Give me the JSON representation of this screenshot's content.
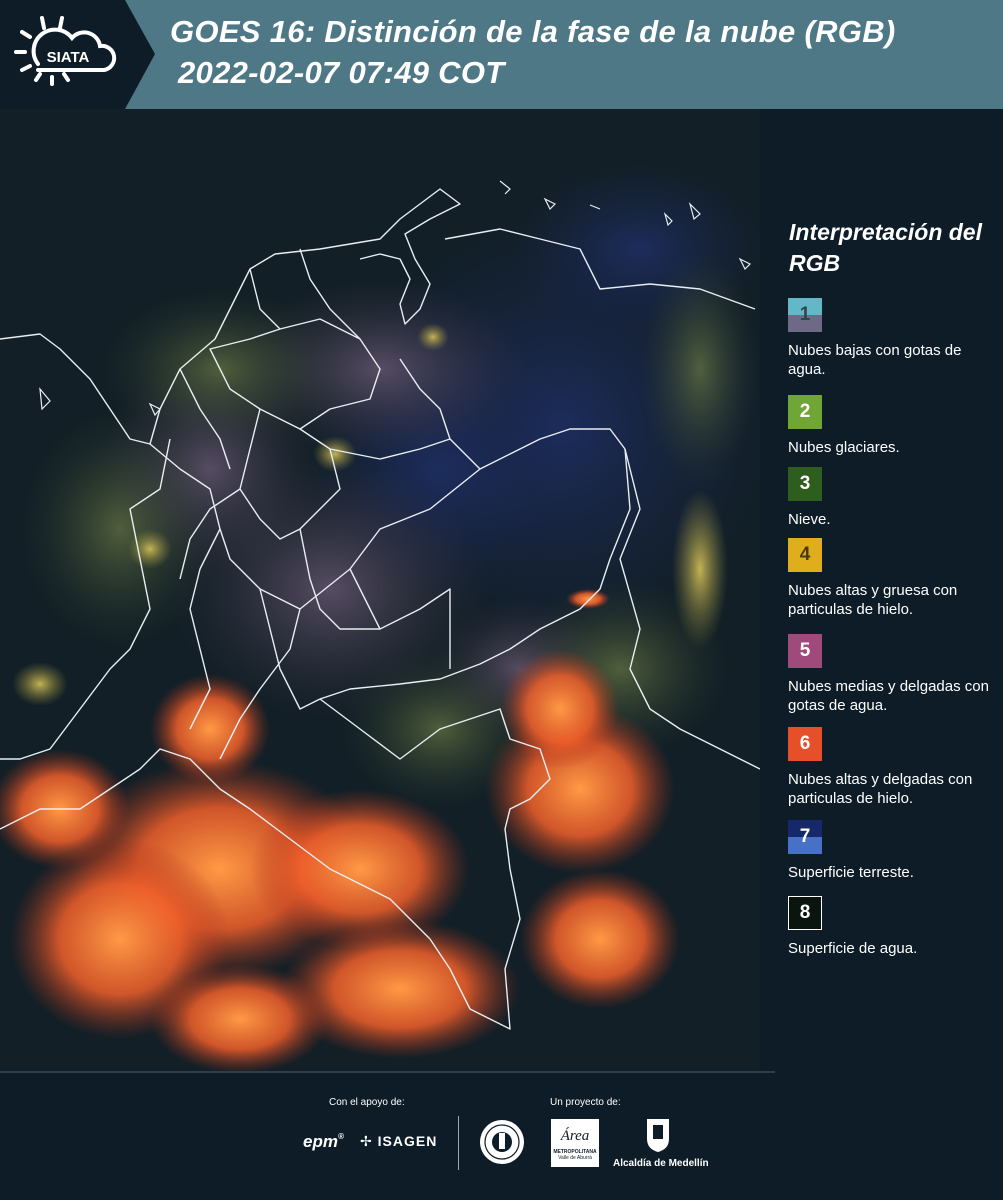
{
  "header": {
    "logo_text": "SIATA",
    "title_line1": "GOES 16: Distinción de la fase de la nube (RGB)",
    "title_line2": "2022-02-07 07:49 COT"
  },
  "legend": {
    "title": "Interpretación del RGB",
    "items": [
      {
        "number": "1",
        "label": "Nubes bajas con gotas de agua.",
        "color_top": "#62b8c6",
        "color_bottom": "#6e6a86",
        "num_color": "#3b3f4c"
      },
      {
        "number": "2",
        "label": "Nubes glaciares.",
        "color_top": "#6fa636",
        "color_bottom": "#6fa636",
        "num_color": "#ffffff"
      },
      {
        "number": "3",
        "label": "Nieve.",
        "color_top": "#2d5e1d",
        "color_bottom": "#2d5e1d",
        "num_color": "#ffffff"
      },
      {
        "number": "4",
        "label": "Nubes altas y gruesa con particulas de hielo.",
        "color_top": "#e0ad1c",
        "color_bottom": "#e0ad1c",
        "num_color": "#4a3a10"
      },
      {
        "number": "5",
        "label": "Nubes medias y delgadas con gotas de agua.",
        "color_top": "#a04a7c",
        "color_bottom": "#a04a7c",
        "num_color": "#ffffff"
      },
      {
        "number": "6",
        "label": "Nubes altas y delgadas con particulas de hielo.",
        "color_top": "#e5502b",
        "color_bottom": "#e5502b",
        "num_color": "#ffffff"
      },
      {
        "number": "7",
        "label": "Superficie terreste.",
        "color_top": "#14286a",
        "color_bottom": "#4671c4",
        "num_color": "#ffffff"
      },
      {
        "number": "8",
        "label": "Superficie de agua.",
        "color_top": "#0b1510",
        "color_bottom": "#0b1510",
        "num_color": "#ffffff"
      }
    ]
  },
  "footer": {
    "support_caption": "Con el apoyo de:",
    "project_caption": "Un proyecto de:",
    "sponsor_epm": "epm",
    "sponsor_isagen": "ISAGEN",
    "area_logo_text": "Área",
    "area_subtitle": "METROPOLITANA",
    "area_subtitle2": "Valle de Aburrá",
    "alcaldia": "Alcaldía de Medellín"
  },
  "colors": {
    "header_bg": "#4f7886",
    "logo_bg": "#0d1c27",
    "page_bg": "#0d1c27",
    "cloud_orange": "#f26a30",
    "water_dark": "#1b2a55"
  },
  "icons": [
    "siata-sun-cloud-icon",
    "isagen-icon",
    "medellin-seal-icon",
    "alcaldia-shield-icon"
  ]
}
